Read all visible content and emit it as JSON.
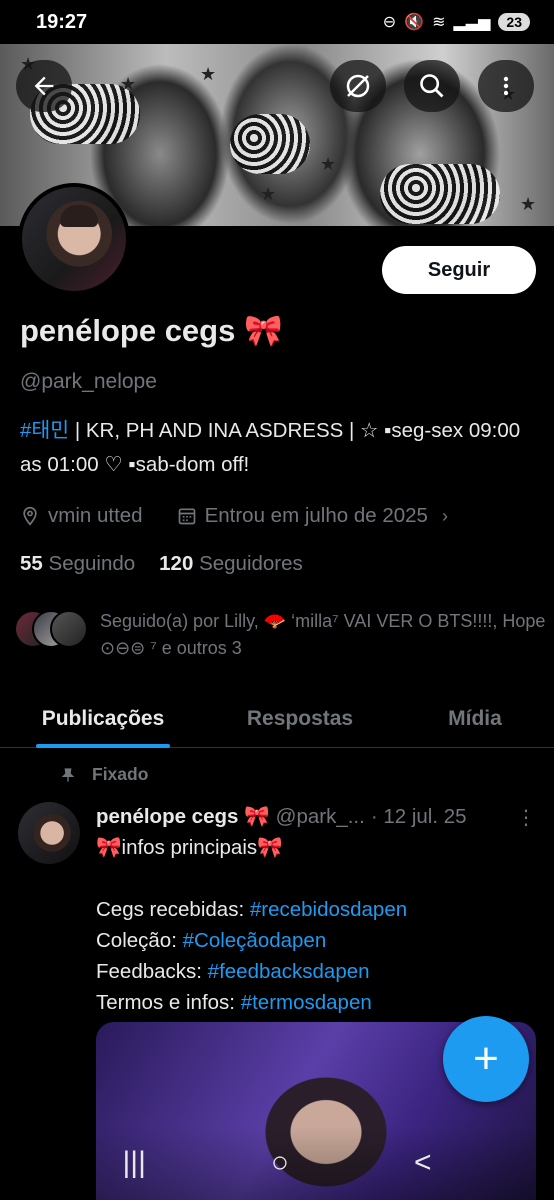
{
  "status_bar": {
    "time": "19:27",
    "battery": "23"
  },
  "header": {
    "back_icon": "back-arrow-icon",
    "grok_icon": "slash-circle-icon",
    "search_icon": "search-icon",
    "more_icon": "more-vertical-icon"
  },
  "profile": {
    "name": "penélope cegs 🎀",
    "handle": "@park_nelope",
    "follow_label": "Seguir",
    "bio_tag": "#태민",
    "bio_rest": " | KR, PH AND INA ASDRESS | ☆ ▪seg-sex 09:00 as 01:00 ♡ ▪sab-dom off!",
    "location": "vmin utted",
    "joined": "Entrou em julho de 2025",
    "following_count": "55",
    "following_label": "Seguindo",
    "followers_count": "120",
    "followers_label": "Seguidores",
    "followed_by": "Seguido(a) por Lilly, 🪭 ‘milla⁷ VAI VER O BTS!!!!, Hope ⊙⊖⊜ ⁷ e outros 3"
  },
  "tabs": [
    {
      "label": "Publicações",
      "active": true
    },
    {
      "label": "Respostas",
      "active": false
    },
    {
      "label": "Mídia",
      "active": false
    }
  ],
  "post": {
    "pinned_label": "Fixado",
    "author": "penélope cegs 🎀",
    "handle": "@park_...",
    "date": "· 12 jul. 25",
    "line1": "🎀infos principais🎀",
    "l2_label": "Cegs recebidas: ",
    "l2_tag": "#recebidosdapen",
    "l3_label": "Coleção: ",
    "l3_tag": "#Coleçãodapen",
    "l4_label": "Feedbacks: ",
    "l4_tag": "#feedbacksdapen",
    "l5_label": "Termos e infos: ",
    "l5_tag": "#termosdapen"
  },
  "fab_label": "+",
  "nav": {
    "recents": "|||",
    "home": "○",
    "back": "<"
  },
  "colors": {
    "accent": "#1d9bf0",
    "background": "#000000",
    "muted": "#71767b"
  }
}
